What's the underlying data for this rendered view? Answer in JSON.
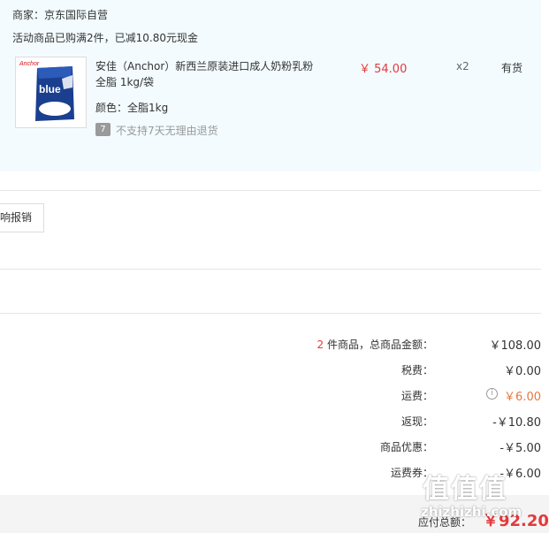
{
  "shop": {
    "merchant": "商家：京东国际自营",
    "promo": "活动商品已购满2件，已减10.80元现金"
  },
  "item": {
    "title_line1": "安佳（Anchor）新西兰原装进口成人奶粉乳粉",
    "title_line2": "全脂 1kg/袋",
    "spec": "颜色：全脂1kg",
    "return_badge": "7",
    "return_note": "不支持7天无理由退货",
    "price": "￥ 54.00",
    "quantity": "x2",
    "stock": "有货",
    "image": {
      "brand_text": "Anchor",
      "pack_text": "blue",
      "colors": {
        "bag": "#1a3f8f",
        "milk": "#ffffff"
      }
    }
  },
  "invoice": {
    "button_label": "响报销"
  },
  "summary": {
    "count_prefix": "2",
    "count_suffix": " 件商品，总商品金额：",
    "goods_amount": "￥108.00",
    "tax_label": "税费：",
    "tax": "￥0.00",
    "shipping_label": "运费：",
    "shipping": "￥6.00",
    "cashback_label": "返现：",
    "cashback": "-￥10.80",
    "discount_label": "商品优惠：",
    "discount": "-￥5.00",
    "shipping_discount_label": "运费券：",
    "shipping_discount": "-￥6.00",
    "info_icon": "i"
  },
  "total": {
    "label": "应付总额：",
    "value": "￥92.20"
  },
  "watermark": {
    "text": "值值值",
    "url": "zhizhizhi.com"
  },
  "colors": {
    "panel": "#f3fbfe",
    "price": "#e4393c",
    "border": "#e6e6e6"
  }
}
